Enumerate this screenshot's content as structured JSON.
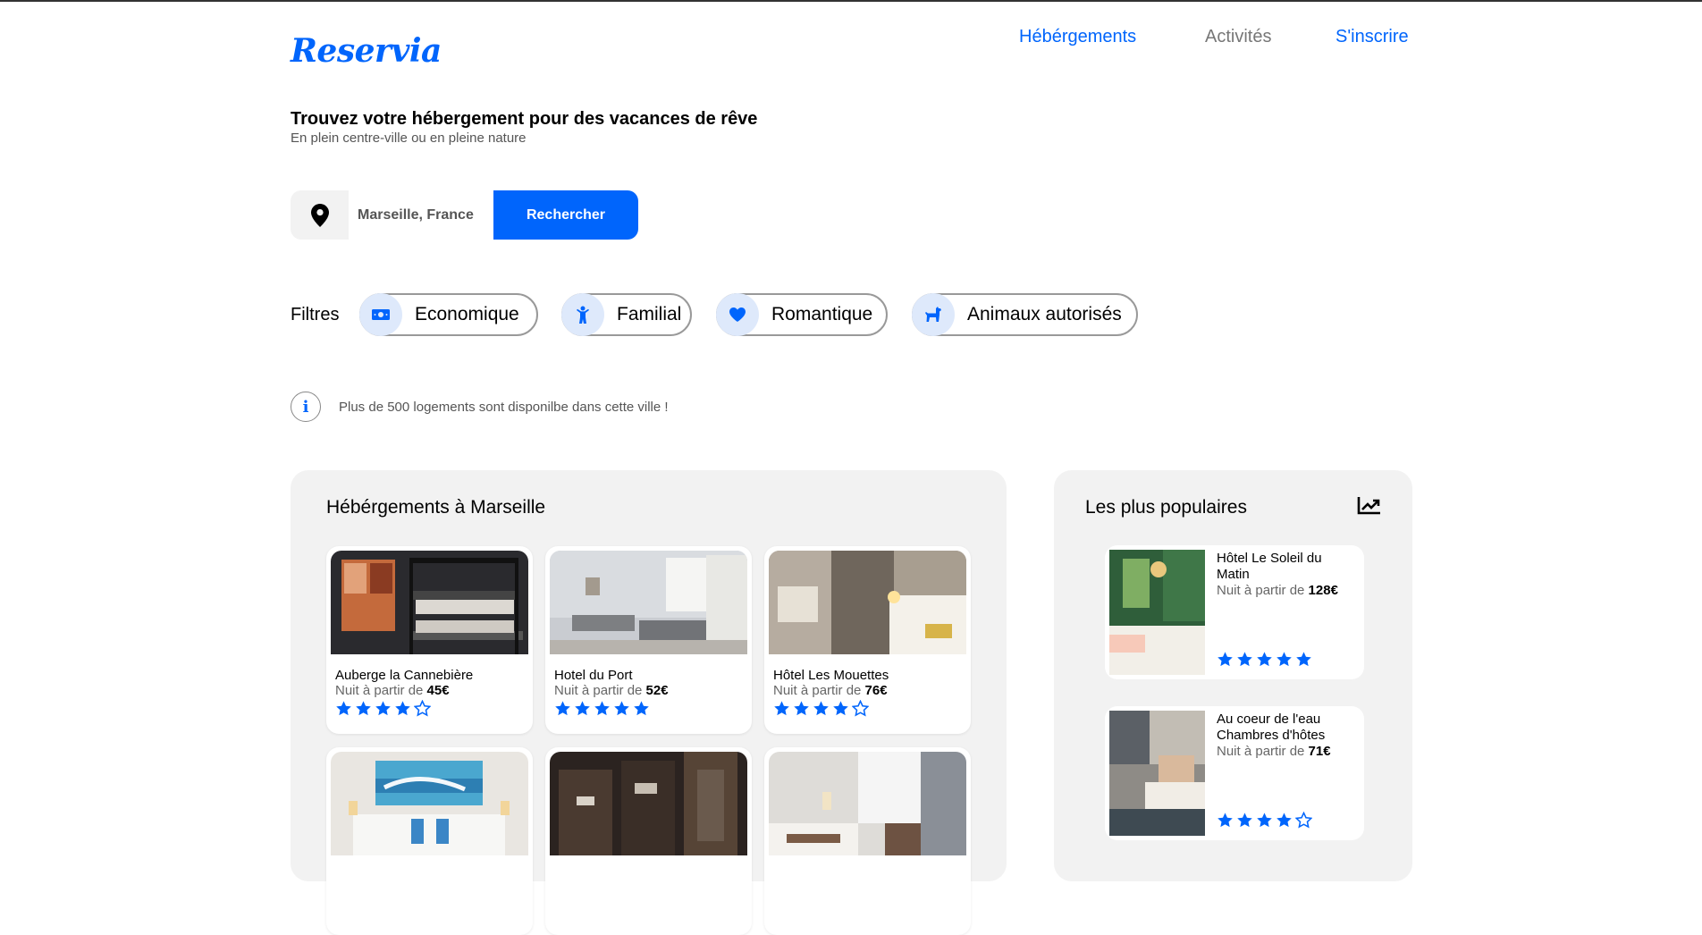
{
  "header": {
    "logo": "Reservia",
    "nav": [
      "Hébérgements",
      "Activités",
      "S'inscrire"
    ]
  },
  "hero": {
    "title": "Trouvez votre hébergement pour des vacances de rêve",
    "subtitle": "En plein centre-ville ou en pleine nature"
  },
  "search": {
    "value": "Marseille, France",
    "button": "Rechercher",
    "icon": "map-pin-icon"
  },
  "filters": {
    "label": "Filtres",
    "items": [
      {
        "label": "Economique",
        "icon": "money-icon"
      },
      {
        "label": "Familial",
        "icon": "child-icon"
      },
      {
        "label": "Romantique",
        "icon": "heart-icon"
      },
      {
        "label": "Animaux autorisés",
        "icon": "dog-icon"
      }
    ]
  },
  "info": {
    "text": "Plus de 500 logements sont disponilbe dans cette ville !",
    "icon": "info-icon"
  },
  "listings": {
    "title": "Hébérgements à Marseille",
    "price_prefix": "Nuit à partir de ",
    "items": [
      {
        "name": "Auberge la Cannebière",
        "price": "45€",
        "rating": 4
      },
      {
        "name": "Hotel du Port",
        "price": "52€",
        "rating": 5
      },
      {
        "name": "Hôtel Les Mouettes",
        "price": "76€",
        "rating": 4
      },
      {
        "name": "",
        "price": "",
        "rating": 0
      },
      {
        "name": "",
        "price": "",
        "rating": 0
      },
      {
        "name": "",
        "price": "",
        "rating": 0
      }
    ]
  },
  "popular": {
    "title": "Les plus populaires",
    "icon": "trending-up-icon",
    "price_prefix": "Nuit à partir de ",
    "items": [
      {
        "name": "Hôtel Le Soleil du Matin",
        "price": "128€",
        "rating": 5
      },
      {
        "name": "Au coeur de l'eau Chambres d'hôtes",
        "price": "71€",
        "rating": 4
      }
    ]
  },
  "colors": {
    "accent": "#0065fc",
    "panel_bg": "#f2f2f2",
    "chip_icon_bg": "#dee9fb"
  }
}
